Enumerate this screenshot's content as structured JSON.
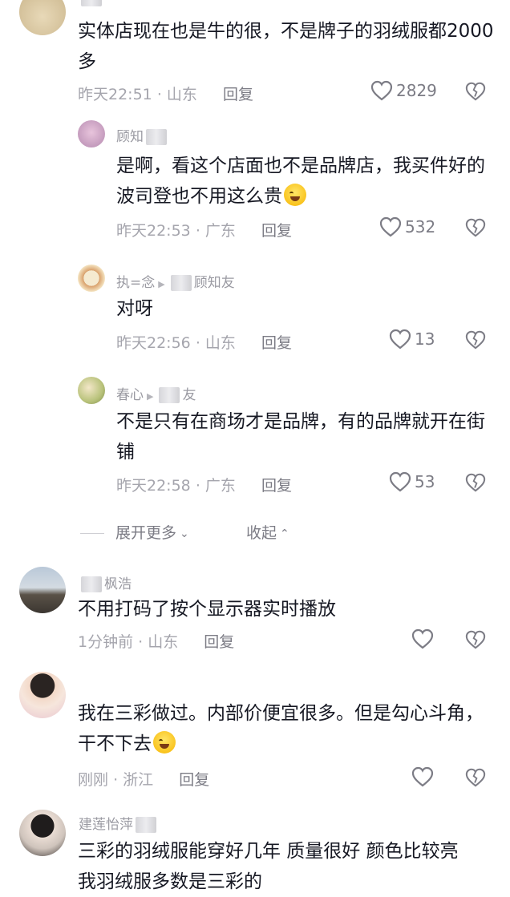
{
  "comments": [
    {
      "text": "实体店现在也是牛的很，不是牌子的羽绒服都2000多",
      "time": "昨天22:51",
      "region": "山东",
      "reply_label": "回复",
      "likes": "2829"
    },
    {
      "username": "顾知",
      "text": "是啊，看这个店面也不是品牌店，我买件好的波司登也不用这么贵",
      "time": "昨天22:53",
      "region": "广东",
      "reply_label": "回复",
      "likes": "532"
    },
    {
      "username": "执=念",
      "reply_to": "顾知友",
      "text": "对呀",
      "time": "昨天22:56",
      "region": "山东",
      "reply_label": "回复",
      "likes": "13"
    },
    {
      "username": "春心",
      "reply_to": "友",
      "text": "不是只有在商场才是品牌，有的品牌就开在街铺",
      "time": "昨天22:58",
      "region": "广东",
      "reply_label": "回复",
      "likes": "53"
    },
    {
      "username": "枫浩",
      "text": "不用打码了按个显示器实时播放",
      "time": "1分钟前",
      "region": "山东",
      "reply_label": "回复",
      "likes": ""
    },
    {
      "text": "我在三彩做过。内部价便宜很多。但是勾心斗角，干不下去",
      "time": "刚刚",
      "region": "浙江",
      "reply_label": "回复",
      "likes": ""
    },
    {
      "username": "建莲怡萍",
      "text": "三彩的羽绒服能穿好几年 质量很好 颜色比较亮",
      "text2": "我羽绒服多数是三彩的"
    }
  ],
  "thread": {
    "expand_label": "展开更多",
    "collapse_label": "收起"
  },
  "meta_separator": "·",
  "icons": {
    "like": "heart-outline-icon",
    "dislike": "broken-heart-icon",
    "emoji_1": "laugh-cry-emoji",
    "emoji_2": "rofl-emoji"
  },
  "colors": {
    "text": "#161823",
    "meta": "#a5a5ad",
    "icon": "#7c7c85"
  }
}
